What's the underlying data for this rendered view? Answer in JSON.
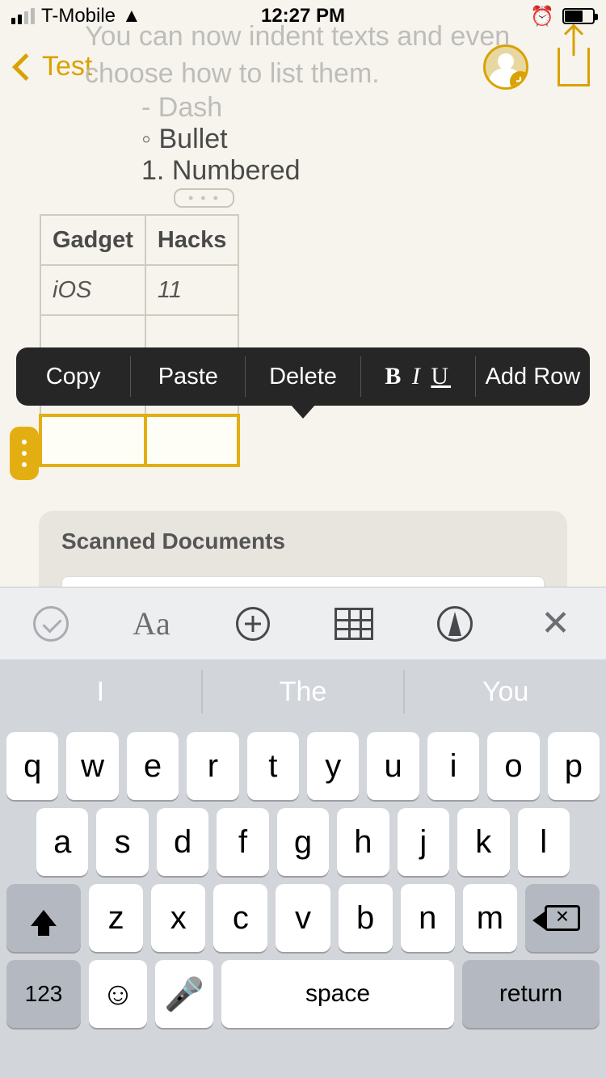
{
  "status": {
    "carrier": "T-Mobile",
    "time": "12:27 PM"
  },
  "nav": {
    "back_label": "Test"
  },
  "note": {
    "line1": "You can now indent texts and even",
    "line2": "choose how to list them.",
    "dash": "Dash",
    "bullet": "Bullet",
    "numbered": "Numbered",
    "toggle": "• • •"
  },
  "table": {
    "head": [
      "Gadget",
      "Hacks"
    ],
    "row1": [
      "iOS",
      "11"
    ]
  },
  "ctx": {
    "copy": "Copy",
    "paste": "Paste",
    "delete": "Delete",
    "addrow": "Add Row"
  },
  "scanned": {
    "title": "Scanned Documents"
  },
  "fmt": {
    "aa": "Aa"
  },
  "sugg": {
    "s1": "I",
    "s2": "The",
    "s3": "You"
  },
  "keys": {
    "r1": [
      "q",
      "w",
      "e",
      "r",
      "t",
      "y",
      "u",
      "i",
      "o",
      "p"
    ],
    "r2": [
      "a",
      "s",
      "d",
      "f",
      "g",
      "h",
      "j",
      "k",
      "l"
    ],
    "r3": [
      "z",
      "x",
      "c",
      "v",
      "b",
      "n",
      "m"
    ],
    "k123": "123",
    "space": "space",
    "return": "return"
  }
}
